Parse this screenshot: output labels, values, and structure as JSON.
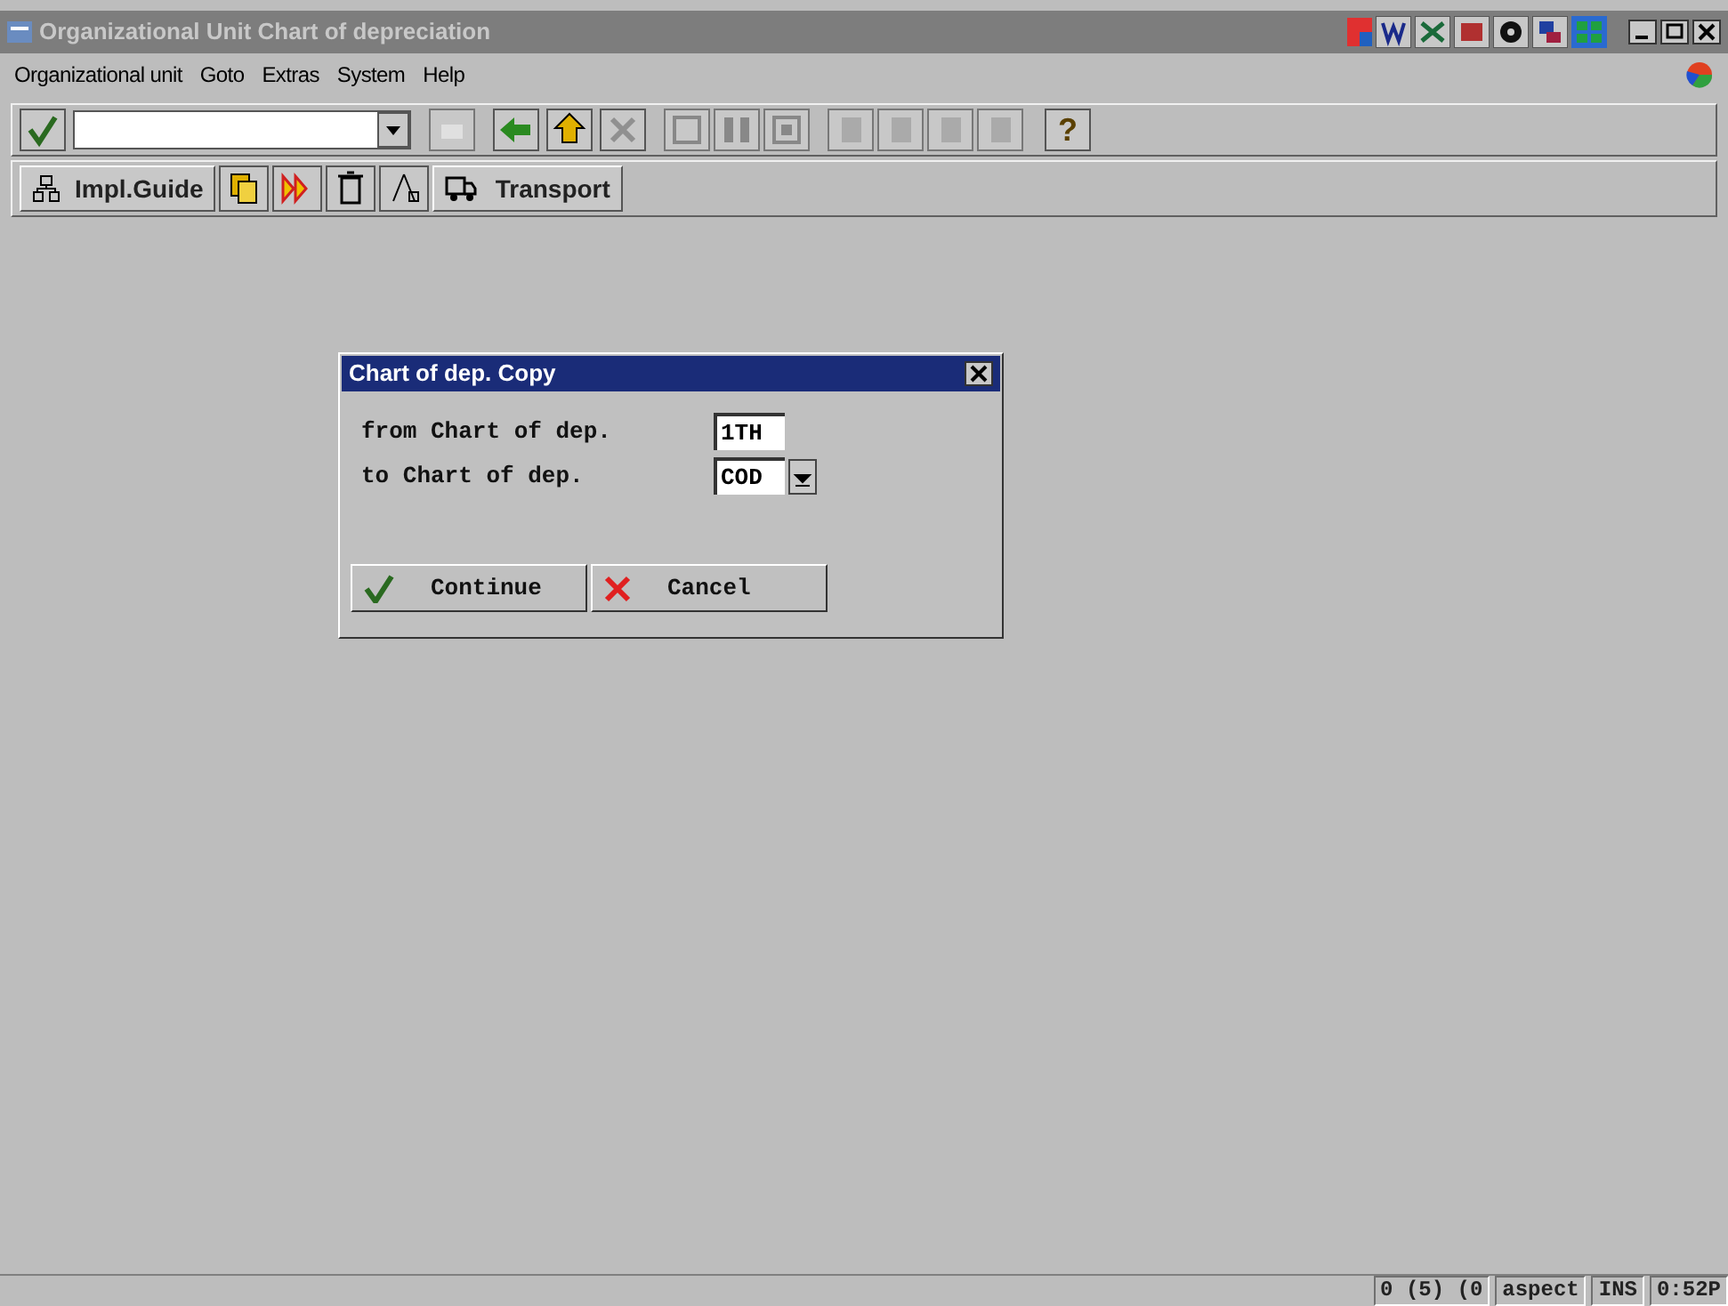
{
  "window": {
    "title": "Organizational Unit Chart of depreciation"
  },
  "menu": [
    "Organizational unit",
    "Goto",
    "Extras",
    "System",
    "Help"
  ],
  "app_toolbar": {
    "impl_guide": "Impl.Guide",
    "transport": "Transport"
  },
  "help_button": "?",
  "dialog": {
    "title": "Chart of dep. Copy",
    "fields": [
      {
        "label": "from Chart of dep.",
        "value": "1TH",
        "dropdown": false
      },
      {
        "label": "to Chart of dep.",
        "value": "COD",
        "dropdown": true
      }
    ],
    "buttons": [
      {
        "kind": "confirm",
        "label": "Continue"
      },
      {
        "kind": "cancel",
        "label": "Cancel"
      }
    ]
  },
  "status_bar": [
    "0 (5) (0",
    "aspect",
    "INS",
    "0:52P"
  ]
}
